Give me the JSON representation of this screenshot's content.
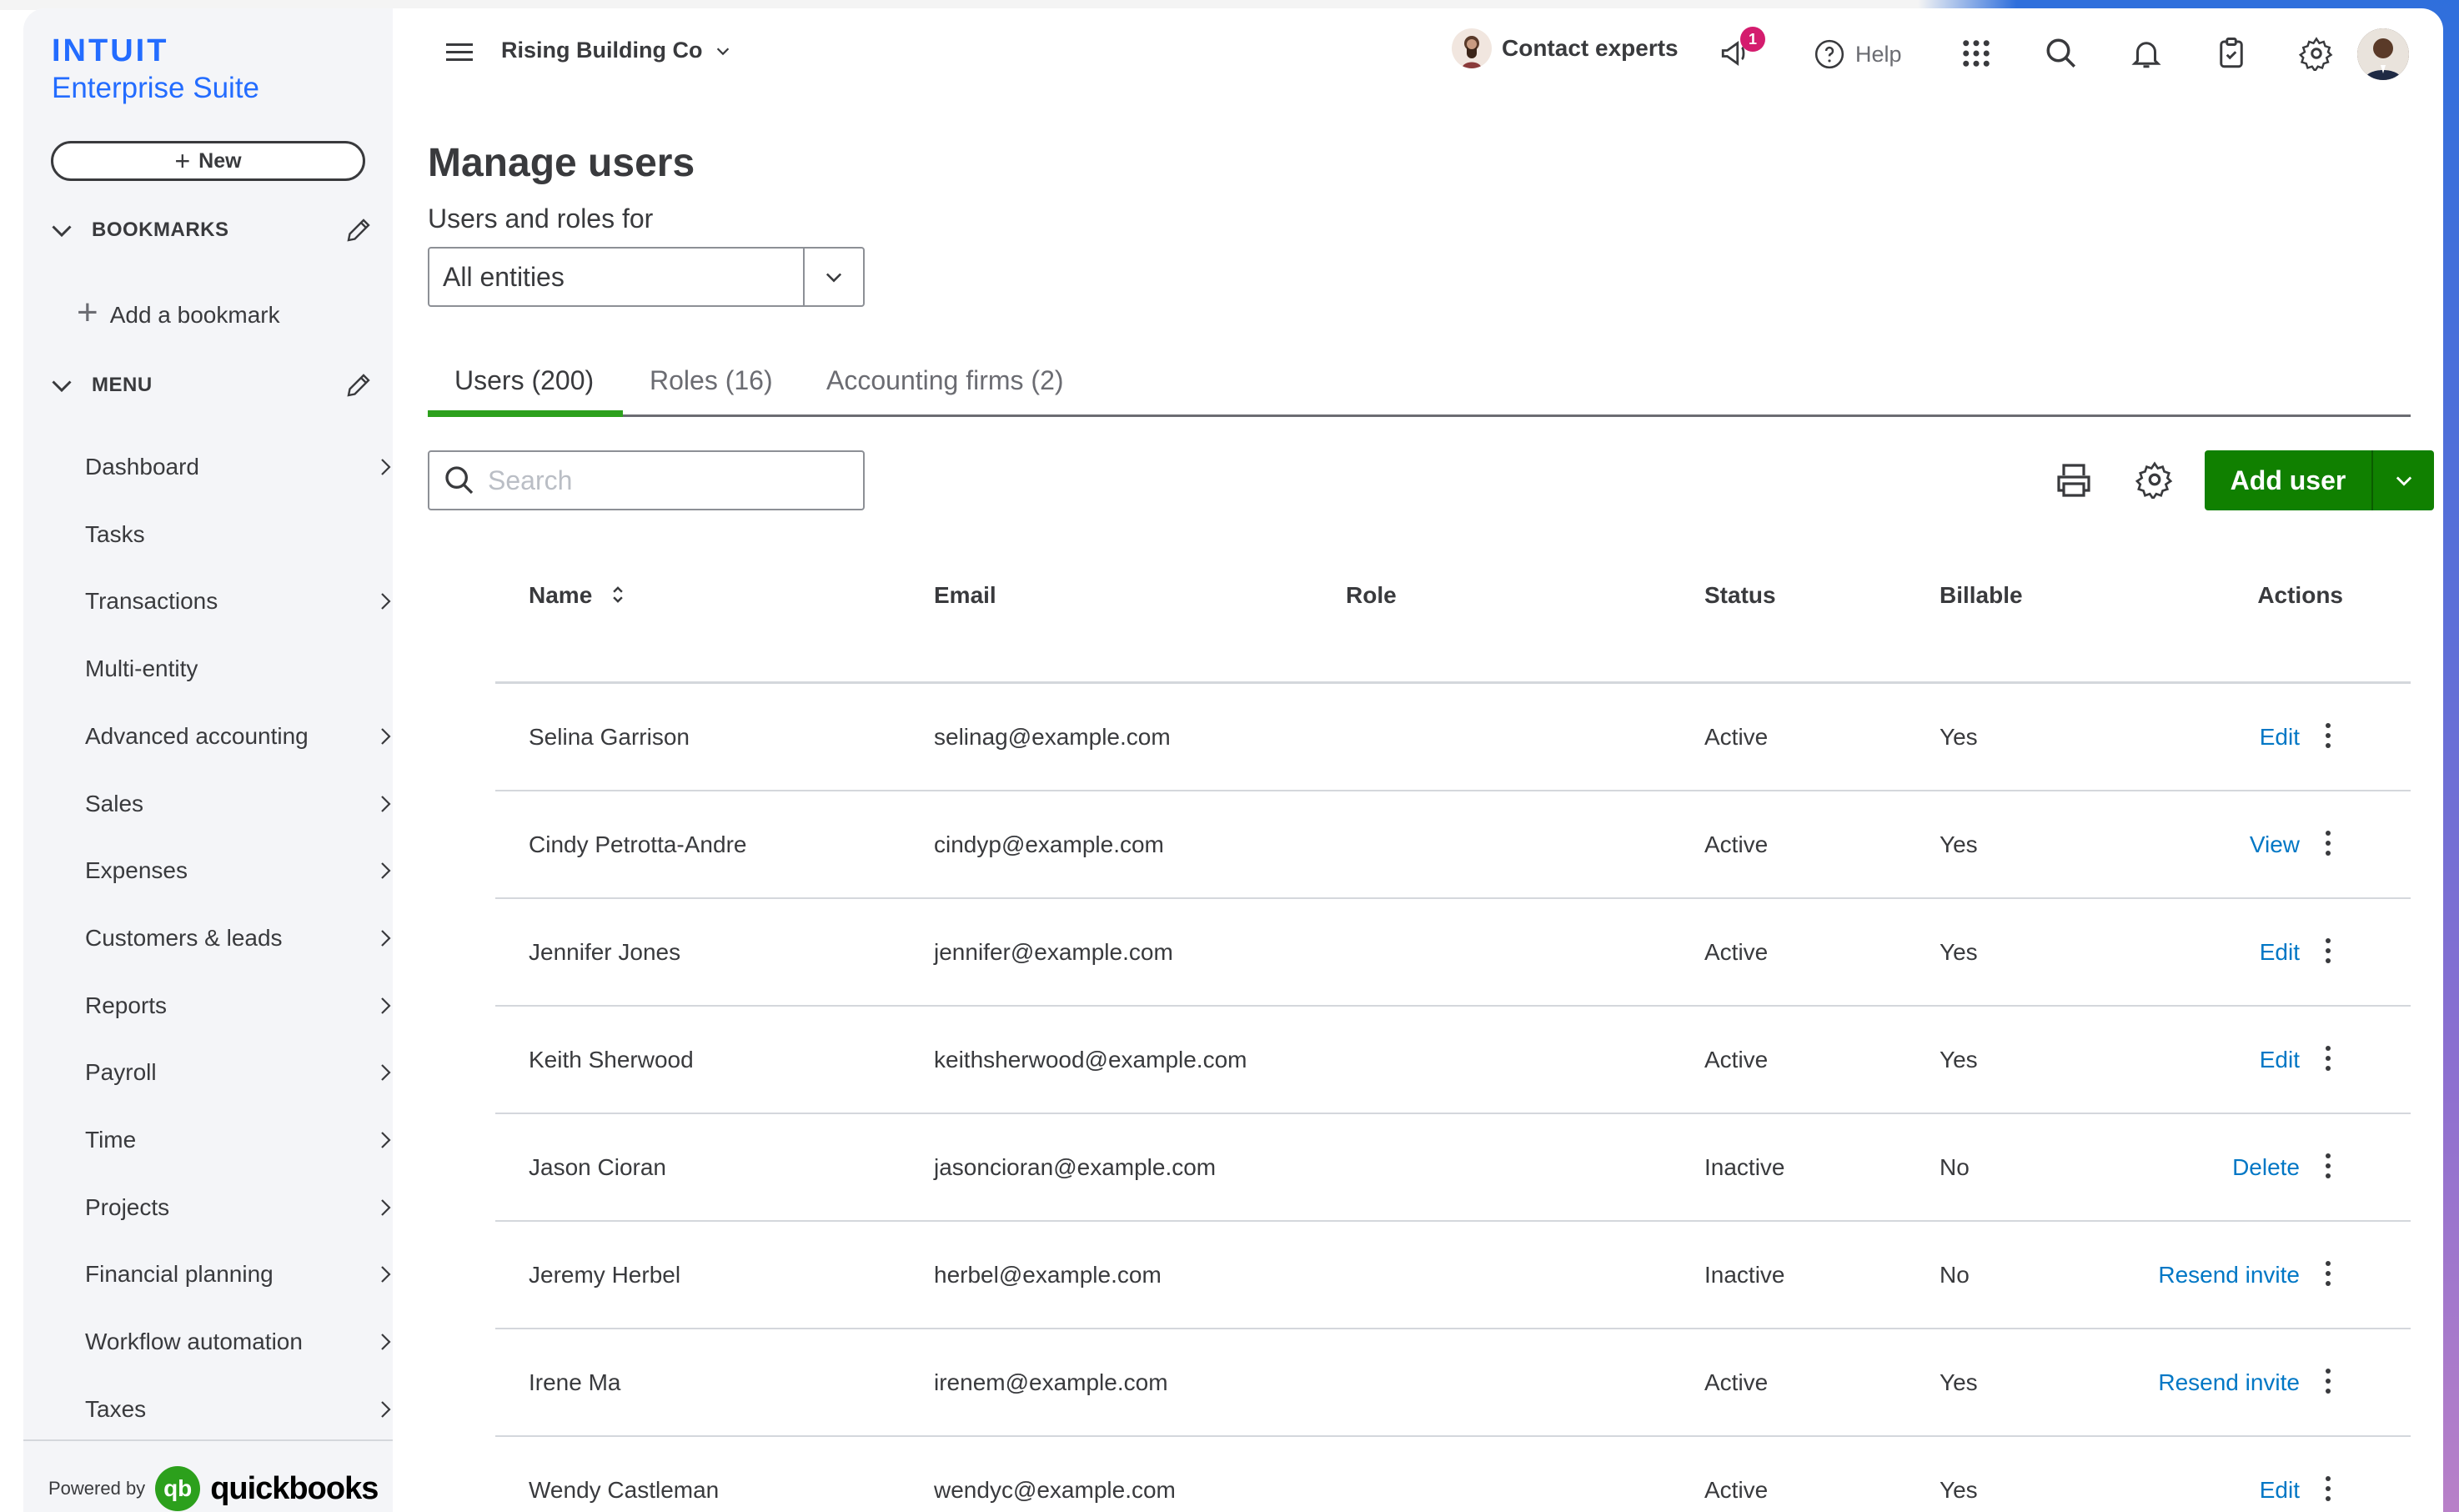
{
  "brand": {
    "name": "INTUIT",
    "product": "Enterprise Suite",
    "powered_by": "Powered by",
    "qb_word": "quickbooks",
    "qb_mark": "qb"
  },
  "sidebar": {
    "new_label": "New",
    "bookmarks_heading": "BOOKMARKS",
    "add_bookmark": "Add a bookmark",
    "menu_heading": "MENU",
    "items": [
      {
        "label": "Dashboard",
        "has_arrow": true
      },
      {
        "label": "Tasks",
        "has_arrow": false
      },
      {
        "label": "Transactions",
        "has_arrow": true
      },
      {
        "label": "Multi-entity",
        "has_arrow": false
      },
      {
        "label": "Advanced accounting",
        "has_arrow": true
      },
      {
        "label": "Sales",
        "has_arrow": true
      },
      {
        "label": "Expenses",
        "has_arrow": true
      },
      {
        "label": "Customers & leads",
        "has_arrow": true
      },
      {
        "label": "Reports",
        "has_arrow": true
      },
      {
        "label": "Payroll",
        "has_arrow": true
      },
      {
        "label": "Time",
        "has_arrow": true
      },
      {
        "label": "Projects",
        "has_arrow": true
      },
      {
        "label": "Financial planning",
        "has_arrow": true
      },
      {
        "label": "Workflow automation",
        "has_arrow": true
      },
      {
        "label": "Taxes",
        "has_arrow": true
      }
    ]
  },
  "topbar": {
    "company": "Rising Building Co",
    "contact": "Contact experts",
    "notification_count": "1",
    "help": "Help"
  },
  "page": {
    "title": "Manage users",
    "subtitle": "Users and roles for",
    "entity_value": "All entities",
    "tabs": [
      "Users (200)",
      "Roles (16)",
      "Accounting firms (2)"
    ],
    "search_placeholder": "Search",
    "add_user": "Add user"
  },
  "table": {
    "columns": [
      "Name",
      "Email",
      "Role",
      "Status",
      "Billable",
      "Actions"
    ],
    "rows": [
      {
        "name": "Selina Garrison",
        "email": "selinag@example.com",
        "role": "",
        "status": "Active",
        "billable": "Yes",
        "action": "Edit"
      },
      {
        "name": "Cindy Petrotta-Andre",
        "email": "cindyp@example.com",
        "role": "",
        "status": "Active",
        "billable": "Yes",
        "action": "View"
      },
      {
        "name": "Jennifer Jones",
        "email": "jennifer@example.com",
        "role": "",
        "status": "Active",
        "billable": "Yes",
        "action": "Edit"
      },
      {
        "name": "Keith Sherwood",
        "email": "keithsherwood@example.com",
        "role": "",
        "status": "Active",
        "billable": "Yes",
        "action": "Edit"
      },
      {
        "name": "Jason Cioran",
        "email": "jasoncioran@example.com",
        "role": "",
        "status": "Inactive",
        "billable": "No",
        "action": "Delete"
      },
      {
        "name": "Jeremy Herbel",
        "email": "herbel@example.com",
        "role": "",
        "status": "Inactive",
        "billable": "No",
        "action": "Resend invite"
      },
      {
        "name": "Irene Ma",
        "email": "irenem@example.com",
        "role": "",
        "status": "Active",
        "billable": "Yes",
        "action": "Resend invite"
      },
      {
        "name": "Wendy Castleman",
        "email": "wendyc@example.com",
        "role": "",
        "status": "Active",
        "billable": "Yes",
        "action": "Edit"
      }
    ]
  },
  "colors": {
    "brand_blue": "#236cff",
    "primary_green": "#108000",
    "tab_green": "#2ca01c",
    "link_blue": "#0077c5",
    "badge_pink": "#d41c6e"
  }
}
